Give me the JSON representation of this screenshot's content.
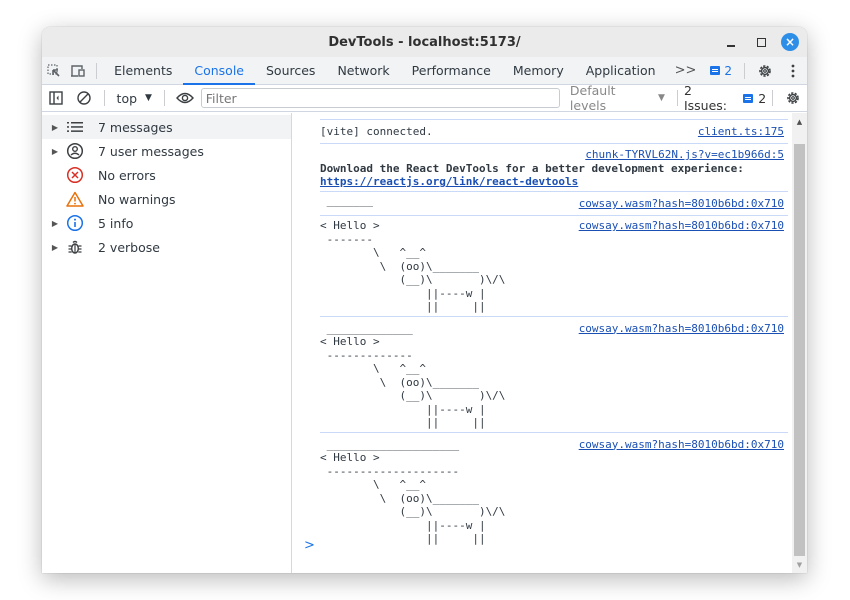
{
  "window": {
    "title": "DevTools - localhost:5173/",
    "controls": {
      "minimize": "minimize",
      "maximize": "maximize",
      "close": "×"
    }
  },
  "tabbar": {
    "tabs": [
      {
        "label": "Elements",
        "active": false
      },
      {
        "label": "Console",
        "active": true
      },
      {
        "label": "Sources",
        "active": false
      },
      {
        "label": "Network",
        "active": false
      },
      {
        "label": "Performance",
        "active": false
      },
      {
        "label": "Memory",
        "active": false
      },
      {
        "label": "Application",
        "active": false
      }
    ],
    "more_label": ">>",
    "messages_badge_count": "2"
  },
  "toolbar": {
    "context": "top",
    "filter_placeholder": "Filter",
    "levels_label": "Default levels",
    "issues_label": "2 Issues:",
    "issues_count": "2"
  },
  "sidebar": {
    "items": [
      {
        "label": "7 messages",
        "icon": "list-icon",
        "expandable": true
      },
      {
        "label": "7 user messages",
        "icon": "user-icon",
        "expandable": true
      },
      {
        "label": "No errors",
        "icon": "error-icon",
        "expandable": false
      },
      {
        "label": "No warnings",
        "icon": "warning-icon",
        "expandable": false
      },
      {
        "label": "5 info",
        "icon": "info-icon",
        "expandable": true
      },
      {
        "label": "2 verbose",
        "icon": "bug-icon",
        "expandable": true
      }
    ]
  },
  "console": {
    "messages": [
      {
        "text": "[vite] connected.",
        "source": "client.ts:175"
      },
      {
        "text": "Download the React DevTools for a better development experience: ",
        "link": "https://reactjs.org/link/react-devtools",
        "source": "chunk-TYRVL62N.js?v=ec1b966d:5"
      },
      {
        "text": " _______",
        "source": "cowsay.wasm?hash=8010b6bd:0x710"
      },
      {
        "text": "< Hello >\n -------\n        \\   ^__^\n         \\  (oo)\\_______\n            (__)\\       )\\/\\\n                ||----w |\n                ||     ||",
        "source": "cowsay.wasm?hash=8010b6bd:0x710"
      },
      {
        "text": " _____________\n< Hello >\n -------------\n        \\   ^__^\n         \\  (oo)\\_______\n            (__)\\       )\\/\\\n                ||----w |\n                ||     ||",
        "source": "cowsay.wasm?hash=8010b6bd:0x710"
      },
      {
        "text": " ____________________\n< Hello >\n --------------------\n        \\   ^__^\n         \\  (oo)\\_______\n            (__)\\       )\\/\\\n                ||----w |\n                ||     ||",
        "source": "cowsay.wasm?hash=8010b6bd:0x710"
      }
    ],
    "prompt": ">"
  },
  "colors": {
    "accent": "#1a73e8",
    "link": "#1a4fb4",
    "error": "#d93025",
    "warning": "#e8710a",
    "close_button": "#2d8ee8"
  }
}
